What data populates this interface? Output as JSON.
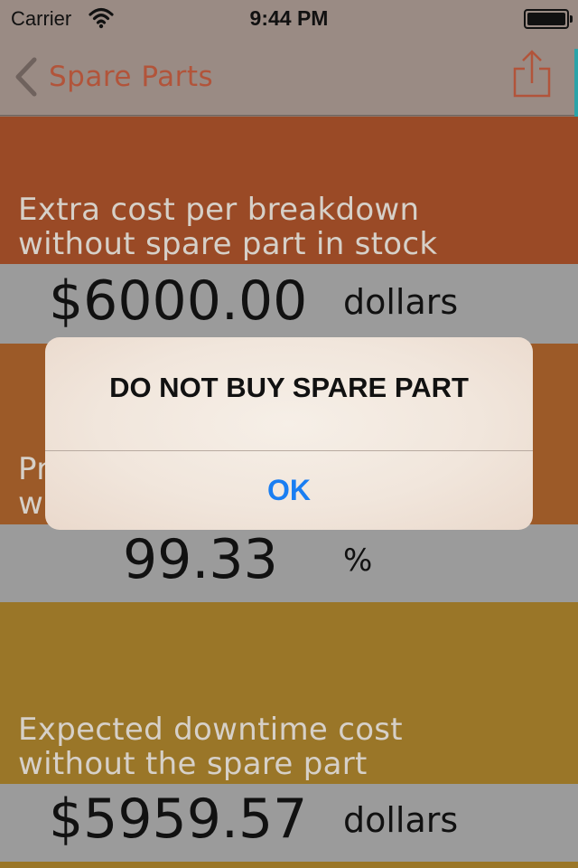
{
  "status_bar": {
    "carrier": "Carrier",
    "time": "9:44 PM"
  },
  "nav": {
    "back_label": "Spare Parts",
    "back_icon": "chevron-left-icon",
    "share_icon": "share-icon"
  },
  "sections": [
    {
      "label_line1": "Extra cost per breakdown",
      "label_line2": "without spare part in stock",
      "value": "$6000.00",
      "unit": "dollars",
      "color": "#9a4a26"
    },
    {
      "label_line1": "Pr",
      "label_line2": "w",
      "value": "99.33",
      "unit": "%",
      "color": "#9c5a28"
    },
    {
      "label_line1": "Expected downtime cost",
      "label_line2": "without the spare part",
      "value": "$5959.57",
      "unit": "dollars",
      "color": "#9a7628"
    }
  ],
  "alert": {
    "title": "DO NOT BUY SPARE PART",
    "button": "OK"
  },
  "colors": {
    "accent": "#1a7ef2",
    "nav_tint": "#b2543a",
    "value_band": "#9b9b9b"
  }
}
